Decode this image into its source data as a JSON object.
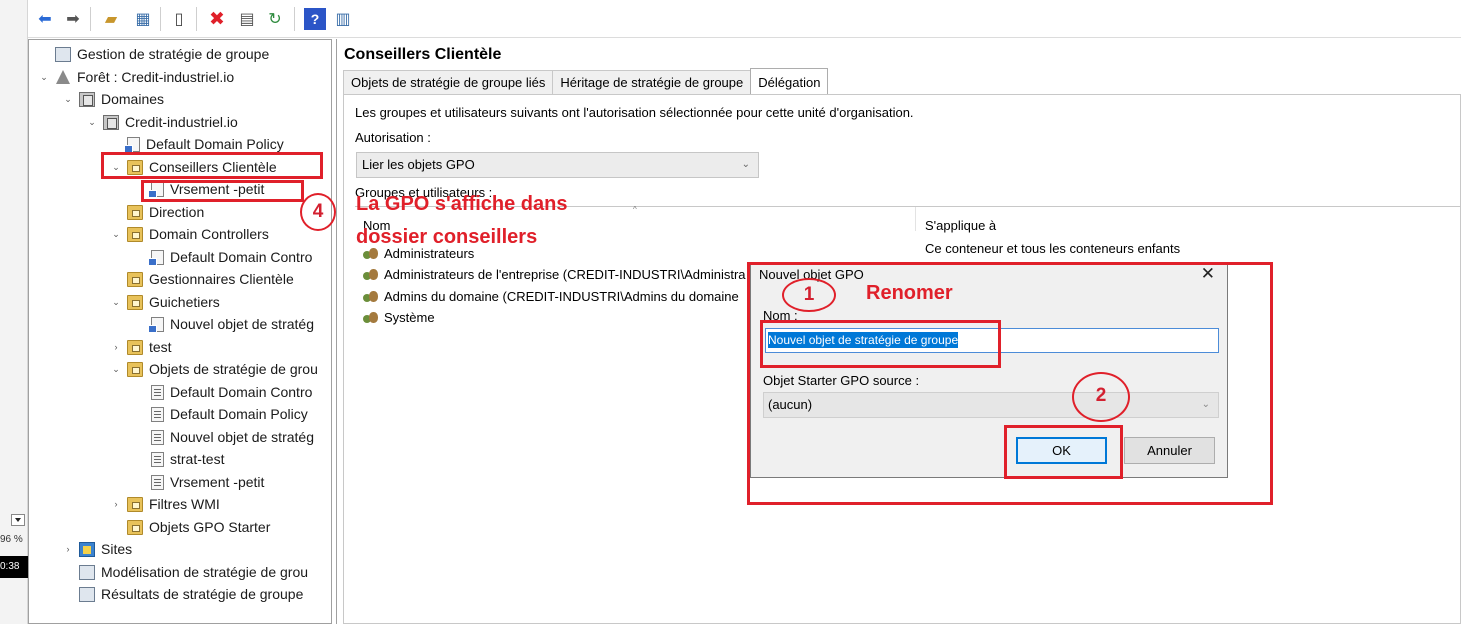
{
  "colors": {
    "annotation_red": "#e0202a",
    "selection_blue": "#0078d7"
  },
  "leftstrip": {
    "percent": "96 %",
    "clock": "0:38"
  },
  "toolbar": {
    "icons": [
      "back-arrow-icon",
      "forward-arrow-icon",
      "up-folder-icon",
      "show-hide-tree-icon",
      "clipboard-icon",
      "delete-icon",
      "properties-icon",
      "refresh-icon",
      "help-icon",
      "view-icon"
    ]
  },
  "tree": {
    "items": [
      {
        "label": "Gestion de stratégie de groupe",
        "twist": "",
        "icon": "mmc"
      },
      {
        "label": "Forêt : Credit-industriel.io",
        "twist": "⌄",
        "icon": "forest"
      },
      {
        "label": "Domaines",
        "twist": "⌄",
        "icon": "domain"
      },
      {
        "label": "Credit-industriel.io",
        "twist": "⌄",
        "icon": "domain"
      },
      {
        "label": "Default Domain Policy",
        "twist": "",
        "icon": "gpolink"
      },
      {
        "label": "Conseillers Clientèle",
        "twist": "⌄",
        "icon": "folder"
      },
      {
        "label": "Vrsement -petit",
        "twist": "",
        "icon": "gpolink"
      },
      {
        "label": "Direction",
        "twist": "",
        "icon": "folder"
      },
      {
        "label": "Domain Controllers",
        "twist": "⌄",
        "icon": "folder"
      },
      {
        "label": "Default Domain Contro",
        "twist": "",
        "icon": "gpolink"
      },
      {
        "label": "Gestionnaires Clientèle",
        "twist": "",
        "icon": "folder"
      },
      {
        "label": "Guichetiers",
        "twist": "⌄",
        "icon": "folder"
      },
      {
        "label": "Nouvel objet de stratég",
        "twist": "",
        "icon": "gpolink"
      },
      {
        "label": "test",
        "twist": "›",
        "icon": "folder"
      },
      {
        "label": "Objets de stratégie de grou",
        "twist": "⌄",
        "icon": "folder"
      },
      {
        "label": "Default Domain Contro",
        "twist": "",
        "icon": "doc"
      },
      {
        "label": "Default Domain Policy",
        "twist": "",
        "icon": "doc"
      },
      {
        "label": "Nouvel objet de stratég",
        "twist": "",
        "icon": "doc"
      },
      {
        "label": "strat-test",
        "twist": "",
        "icon": "doc"
      },
      {
        "label": "Vrsement -petit",
        "twist": "",
        "icon": "doc"
      },
      {
        "label": "Filtres WMI",
        "twist": "›",
        "icon": "folder"
      },
      {
        "label": "Objets GPO Starter",
        "twist": "",
        "icon": "folder"
      },
      {
        "label": "Sites",
        "twist": "›",
        "icon": "sites"
      },
      {
        "label": "Modélisation de stratégie de grou",
        "twist": "",
        "icon": "mmc"
      },
      {
        "label": "Résultats de stratégie de groupe",
        "twist": "",
        "icon": "mmc"
      }
    ]
  },
  "main": {
    "title": "Conseillers Clientèle",
    "tabs": [
      {
        "label": "Objets de stratégie de groupe liés"
      },
      {
        "label": "Héritage de stratégie de groupe"
      },
      {
        "label": "Délégation"
      }
    ],
    "description": "Les groupes et utilisateurs suivants ont l'autorisation sélectionnée pour cette unité d'organisation.",
    "authorization_label": "Autorisation :",
    "authorization_value": "Lier les objets GPO",
    "groups_label": "Groupes et utilisateurs :",
    "columns": {
      "name": "Nom",
      "applies": "S'applique à"
    },
    "rows": [
      {
        "name": "Administrateurs",
        "applies": "Ce conteneur et tous les conteneurs enfants"
      },
      {
        "name": "Administrateurs de l'entreprise (CREDIT-INDUSTRI\\Administra",
        "applies": ""
      },
      {
        "name": "Admins du domaine (CREDIT-INDUSTRI\\Admins du domaine",
        "applies": ""
      },
      {
        "name": "Système",
        "applies": ""
      }
    ]
  },
  "dialog": {
    "title": "Nouvel objet GPO",
    "name_label": "Nom :",
    "name_value": "Nouvel objet de stratégie de groupe",
    "starter_label": "Objet Starter GPO source :",
    "starter_value": "(aucun)",
    "ok_label": "OK",
    "cancel_label": "Annuler"
  },
  "annotations": {
    "step1": "1",
    "step1_text": "Renomer",
    "step2": "2",
    "step4": "4",
    "step4_text_line1": "La GPO s'affiche dans",
    "step4_text_line2": "dossier conseillers"
  }
}
